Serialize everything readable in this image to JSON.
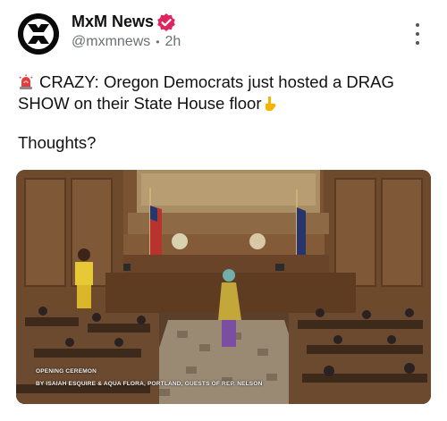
{
  "author": {
    "name": "MxM News",
    "handle": "@mxmnews",
    "separator": "•",
    "time": "2h",
    "verified_color": "#e0245e",
    "avatar_icon": "mxm-logo-icon"
  },
  "post": {
    "line1": "CRAZY: Oregon Democrats just hosted a DRAG",
    "line2": "SHOW on their State House floor",
    "line3": "Thoughts?",
    "leading_emoji": "police-siren-icon",
    "trailing_emoji": "pointing-down-icon"
  },
  "video": {
    "caption_line1": "OPENING CEREMON",
    "caption_line2": "BY ISAIAH ESQUIRE & AQUA FLORA, PORTLAND, GUESTS OF REP. NELSON"
  },
  "menu": {
    "icon": "more-options-icon"
  }
}
